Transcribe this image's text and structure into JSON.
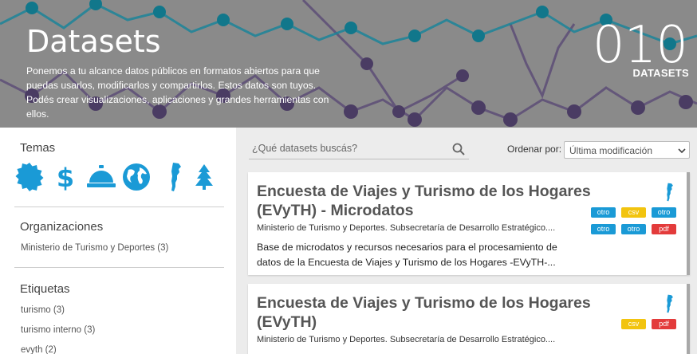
{
  "hero": {
    "title": "Datasets",
    "description": "Ponemos a tu alcance datos públicos en formatos abiertos para que puedas usarlos, modificarlos y compartirlos. Estos datos son tuyos. Podés crear visualizaciones, aplicaciones y grandes herramientas con ellos.",
    "count": "010",
    "count_label": "DATASETS"
  },
  "sidebar": {
    "themes_heading": "Temas",
    "theme_icons": [
      "badge-icon",
      "dollar-icon",
      "service-bell-icon",
      "globe-icon",
      "argentina-map-icon",
      "tree-icon"
    ],
    "organizations_heading": "Organizaciones",
    "organizations": [
      "Ministerio de Turismo y Deportes (3)"
    ],
    "tags_heading": "Etiquetas",
    "tags": [
      "turismo (3)",
      "turismo interno (3)",
      "evyth (2)"
    ]
  },
  "search": {
    "placeholder": "¿Qué datasets buscás?"
  },
  "sort": {
    "label": "Ordenar por:",
    "selected": "Última modificación"
  },
  "datasets": [
    {
      "title": "Encuesta de Viajes y Turismo de los Hogares (EVyTH) - Microdatos",
      "organization": "Ministerio de Turismo y Deportes. Subsecretaría de Desarrollo Estratégico....",
      "description": "Base de microdatos y recursos necesarios para el procesamiento de datos de la Encuesta de Viajes y Turismo de los Hogares -EVyTH-...",
      "formats": [
        "otro",
        "csv",
        "otro",
        "otro",
        "otro",
        "pdf"
      ]
    },
    {
      "title": "Encuesta de Viajes y Turismo de los Hogares (EVyTH)",
      "organization": "Ministerio de Turismo y Deportes. Subsecretaría de Desarrollo Estratégico....",
      "formats": [
        "csv",
        "pdf"
      ]
    }
  ],
  "colors": {
    "accent": "#1a9ad6",
    "csv": "#f2c40f",
    "pdf": "#e33b3b",
    "hero_bg": "#8a8a8a"
  }
}
